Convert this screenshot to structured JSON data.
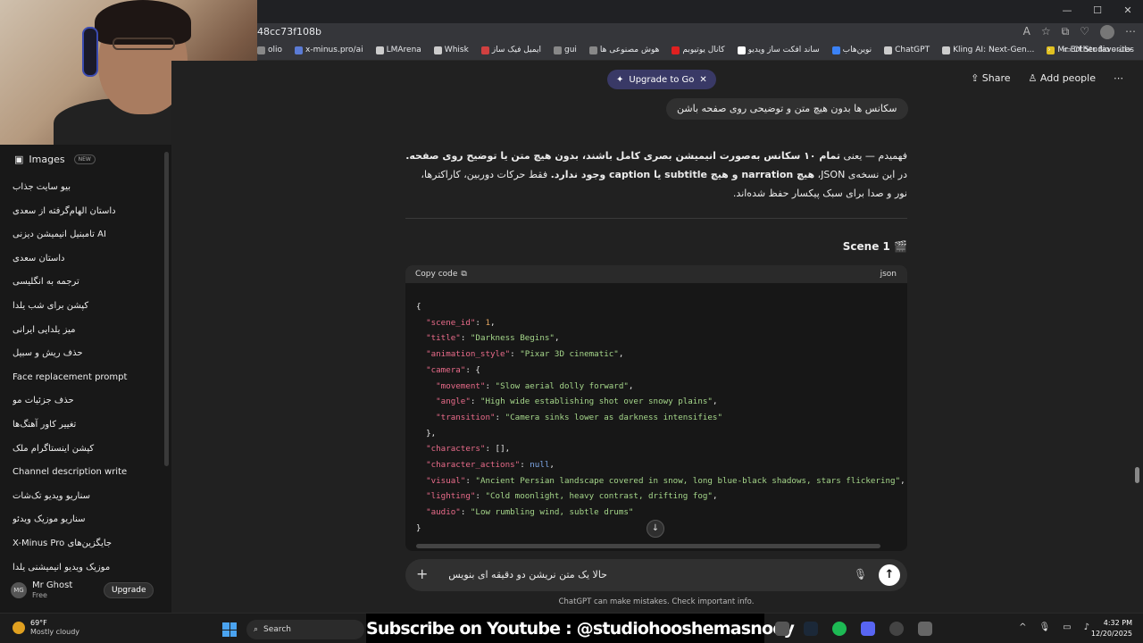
{
  "browser": {
    "url_fragment": "48cc73f108b",
    "bookmarks": [
      {
        "label": "olio",
        "color": "#888888"
      },
      {
        "label": "x-minus.pro/ai",
        "color": "#5b7bd5"
      },
      {
        "label": "LMArena",
        "color": "#cccccc"
      },
      {
        "label": "Whisk",
        "color": "#cccccc"
      },
      {
        "label": "ایمیل فیک ساز",
        "color": "#d04040"
      },
      {
        "label": "gui",
        "color": "#888888"
      },
      {
        "label": "هوش مصنوعی ها",
        "color": "#888888"
      },
      {
        "label": "کانال یوتیوبم",
        "color": "#e02020"
      },
      {
        "label": "ساند افکت ساز ویدیو",
        "color": "#ffffff"
      },
      {
        "label": "نوین‌هاب",
        "color": "#3b82f6"
      },
      {
        "label": "ChatGPT",
        "color": "#cccccc"
      },
      {
        "label": "Kling AI: Next-Gen...",
        "color": "#cccccc"
      },
      {
        "label": "Mr Erf Studio - خانه",
        "color": "#e0c020"
      }
    ],
    "other_favorites": "Other favorites"
  },
  "sidebar": {
    "images_label": "Images",
    "images_badge": "NEW",
    "items": [
      "بیو سایت جذاب",
      "داستان الهام‌گرفته از سعدی",
      "تامبنیل انیمیشن دیزنی AI",
      "داستان سعدی",
      "ترجمه به انگلیسی",
      "کپشن برای شب یلدا",
      "میز یلدایی ایرانی",
      "حذف ریش و سبیل",
      "Face replacement prompt",
      "حذف جزئیات مو",
      "تغییر کاور آهنگ‌ها",
      "کپشن اینستاگرام ملک",
      "Channel description write",
      "سناریو ویدیو تک‌شات",
      "سناریو موزیک ویدئو",
      "X-Minus Pro جایگزین‌های",
      "موزیک ویدیو انیمیشنی یلدا"
    ],
    "user": {
      "initials": "MG",
      "name": "Mr Ghost",
      "plan": "Free"
    },
    "upgrade_label": "Upgrade"
  },
  "header": {
    "upgrade_pill": "Upgrade to Go",
    "share_label": "Share",
    "add_people_label": "Add people"
  },
  "chat": {
    "user_message": "سکانس ها بدون هیچ متن و توضیحی روی صفحه باشن",
    "reply_line1_plain": "فهمیدم — یعنی ",
    "reply_line1_bold": "تمام ۱۰ سکانس به‌صورت انیمیشن بصری کامل باشند، بدون هیچ متن یا توضیح روی صفحه.",
    "reply_line2_plain": "در این نسخه‌ی JSON، ",
    "reply_line2_bold": "هیچ narration و هیچ subtitle یا caption وجود ندارد.",
    "reply_line2_rest": " فقط حرکات دوربین، کاراکترها، نور و صدا برای سبک پیکسار حفظ شده‌اند.",
    "scene_title": "Scene 1 🎬",
    "copy_code_label": "Copy code",
    "code_lang": "json",
    "composer_text": "حالا یک متن نریشن دو دقیقه ای بنویس",
    "disclaimer": "ChatGPT can make mistakes. Check important info."
  },
  "code_lines": {
    "scene_id_key": "\"scene_id\"",
    "scene_id_val": "1",
    "title_key": "\"title\"",
    "title_val": "\"Darkness Begins\"",
    "style_key": "\"animation_style\"",
    "style_val": "\"Pixar 3D cinematic\"",
    "camera_key": "\"camera\"",
    "movement_key": "\"movement\"",
    "movement_val": "\"Slow aerial dolly forward\"",
    "angle_key": "\"angle\"",
    "angle_val": "\"High wide establishing shot over snowy plains\"",
    "transition_key": "\"transition\"",
    "transition_val": "\"Camera sinks lower as darkness intensifies\"",
    "characters_key": "\"characters\"",
    "characters_val": "[]",
    "actions_key": "\"character_actions\"",
    "actions_val": "null",
    "visual_key": "\"visual\"",
    "visual_val": "\"Ancient Persian landscape covered in snow, long blue-black shadows, stars flickering\"",
    "lighting_key": "\"lighting\"",
    "lighting_val": "\"Cold moonlight, heavy contrast, drifting fog\"",
    "audio_key": "\"audio\"",
    "audio_val": "\"Low rumbling wind, subtle drums\""
  },
  "taskbar": {
    "temp": "69°F",
    "condition": "Mostly cloudy",
    "search_label": "Search",
    "banner": "Subscribe on Youtube : @studiohooshemasnooy",
    "time": "4:32 PM",
    "date": "12/20/2025"
  }
}
